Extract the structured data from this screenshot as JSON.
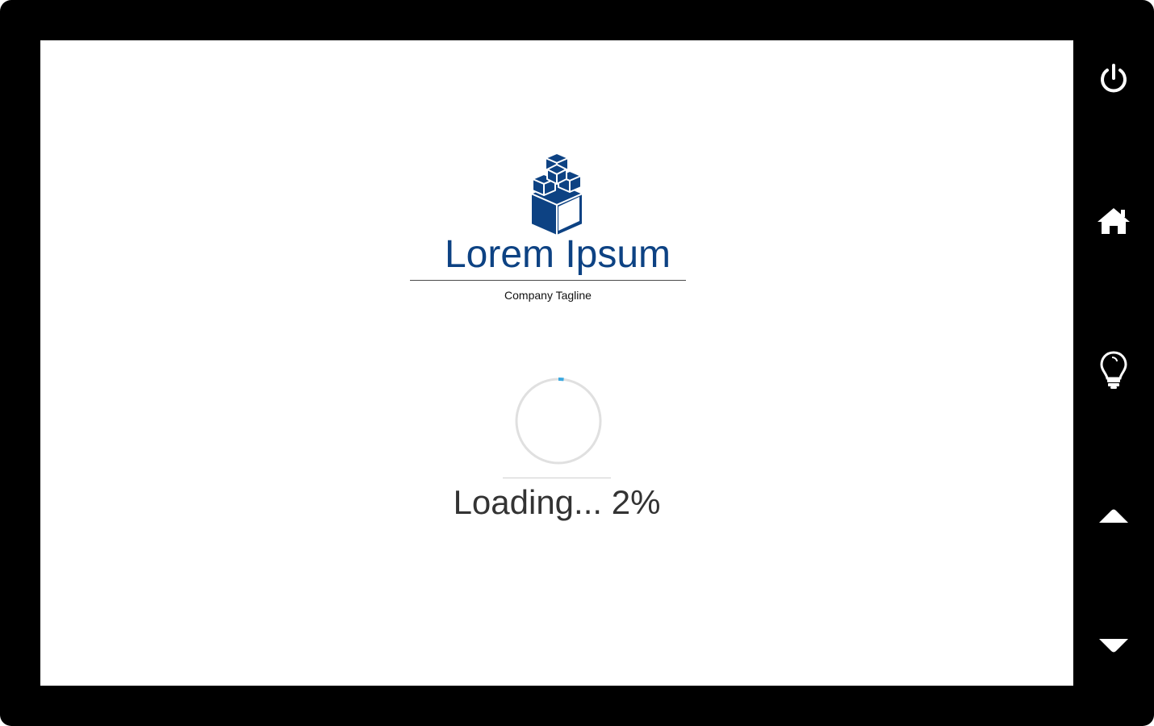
{
  "branding": {
    "company_name": "Lorem Ipsum",
    "tagline": "Company Tagline",
    "logo_icon": "stacked-cubes-icon",
    "brand_color": "#0d4283"
  },
  "loading": {
    "text": "Loading... 2%",
    "progress_percent": 2,
    "spinner_track_color": "#e0e0e0",
    "spinner_arc_color": "#3aa8e0"
  },
  "side_buttons": [
    {
      "icon": "power-icon",
      "action": "power"
    },
    {
      "icon": "home-icon",
      "action": "home"
    },
    {
      "icon": "lightbulb-icon",
      "action": "idea"
    },
    {
      "icon": "chevron-up-icon",
      "action": "scroll-up"
    },
    {
      "icon": "chevron-down-icon",
      "action": "scroll-down"
    }
  ],
  "colors": {
    "frame": "#000000",
    "screen_background": "#ffffff",
    "text_dark": "#333333"
  }
}
